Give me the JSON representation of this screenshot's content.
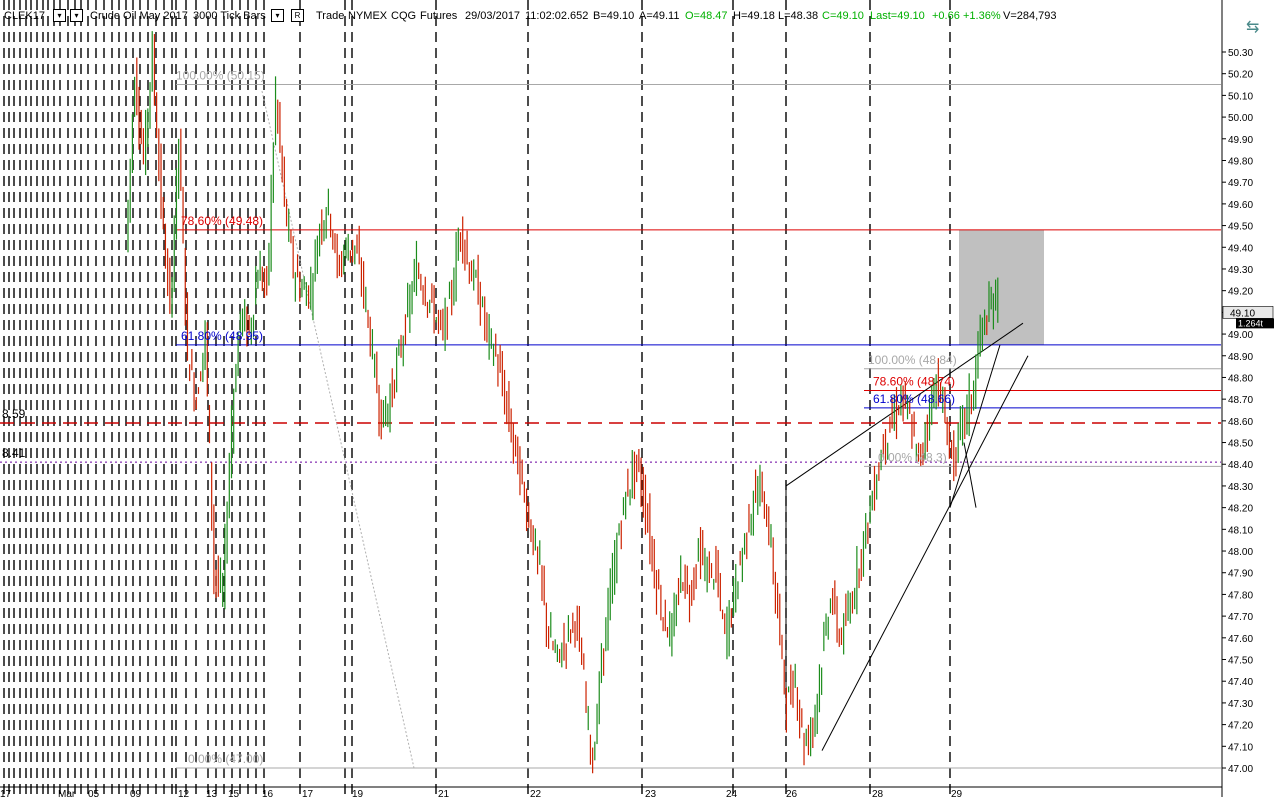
{
  "header": {
    "symbol": "CLEK17",
    "description": "Crude Oil May 2017",
    "bar_type": "3000 Tick Bars",
    "mode": "Trade",
    "exchange": "NYMEX",
    "feed": "CQG",
    "category": "Futures",
    "date": "29/03/2017",
    "time": "11:02:02.652",
    "bid": "B=49.10",
    "ask": "A=49.11",
    "open": "O=48.47",
    "high": "H=49.18",
    "low": "L=48.38",
    "close": "C=49.10",
    "last": "Last=49.10",
    "change": "+0.66",
    "change_pct": "+1.36%",
    "volume": "V=284,793",
    "colors": {
      "text": "#000000",
      "positive": "#00b000"
    }
  },
  "chart_data": {
    "type": "line",
    "ylim": [
      47.0,
      50.4
    ],
    "y_ticks": [
      "50.30",
      "50.20",
      "50.10",
      "50.00",
      "49.90",
      "49.80",
      "49.70",
      "49.60",
      "49.50",
      "49.40",
      "49.30",
      "49.20",
      "49.10",
      "49.00",
      "48.90",
      "48.80",
      "48.70",
      "48.60",
      "48.50",
      "48.40",
      "48.30",
      "48.20",
      "48.10",
      "48.00",
      "47.90",
      "47.80",
      "47.70",
      "47.60",
      "47.50",
      "47.40",
      "47.30",
      "47.20",
      "47.10",
      "47.00"
    ],
    "x_ticks": [
      "17",
      "Mar",
      "05",
      "09",
      "12",
      "13",
      "15",
      "16",
      "17",
      "19",
      "21",
      "22",
      "23",
      "24",
      "26",
      "28",
      "29",
      "29"
    ],
    "last_price": "49.10",
    "last_tag": "1.264t",
    "series": [
      {
        "values": [
          49.4,
          50.2,
          49.8,
          50.3,
          49.6,
          49.1,
          49.9,
          48.9,
          48.7,
          49.0,
          47.9,
          47.8,
          48.6,
          49.1,
          49.0,
          49.3,
          49.2,
          50.1,
          49.6,
          49.3,
          49.2,
          49.2,
          49.5,
          49.6,
          49.3,
          49.4,
          49.4,
          49.2,
          48.9,
          48.6,
          48.7,
          48.9,
          49.1,
          49.3,
          49.2,
          49.1,
          49.0,
          49.2,
          49.5,
          49.3,
          49.2,
          49.0,
          48.9,
          48.7,
          48.5,
          48.3,
          48.1,
          47.9,
          47.6,
          47.5,
          47.6,
          47.7,
          47.4,
          47.0,
          47.5,
          47.8,
          48.1,
          48.3,
          48.4,
          48.2,
          47.9,
          47.7,
          47.6,
          47.9,
          47.8,
          48.0,
          47.9,
          47.9,
          47.6,
          47.8,
          48.0,
          48.2,
          48.3,
          48.1,
          47.7,
          47.3,
          47.4,
          47.1,
          47.2,
          47.5,
          47.8,
          47.6,
          47.7,
          47.9,
          48.1,
          48.3,
          48.5,
          48.6,
          48.7,
          48.6,
          48.4,
          48.6,
          48.8,
          48.6,
          48.4,
          48.6,
          48.7,
          49.0,
          49.1,
          49.2
        ]
      }
    ],
    "annotations": {
      "dashed_price_labels": [
        "8.59",
        "8.41"
      ],
      "fib_left": [
        {
          "label": "100.00% (50.15)",
          "value": 50.15
        },
        {
          "label": "78.60% (49.48)",
          "value": 49.48
        },
        {
          "label": "61.80% (48.95)",
          "value": 48.95
        },
        {
          "label": "0.00% (47.00)",
          "value": 47.0
        }
      ],
      "fib_right": [
        {
          "label": "100.00% (48.84)",
          "value": 48.84
        },
        {
          "label": "78.60% (48.74)",
          "value": 48.74
        },
        {
          "label": "61.80% (48.66)",
          "value": 48.66
        },
        {
          "label": "0.00% (48.3)",
          "value": 48.39
        }
      ],
      "red_dashed_level": 48.59,
      "purple_dotted_level": 48.41,
      "colors": {
        "fib_100": "#a8a8a8",
        "fib_786": "#dd0000",
        "fib_618": "#0000cc",
        "red_dash": "#cc0000",
        "purple_dot": "#6a00a0",
        "up_bar": "#1c8c1c",
        "down_bar": "#cc2200",
        "zone": "#c0c0c0"
      }
    }
  }
}
